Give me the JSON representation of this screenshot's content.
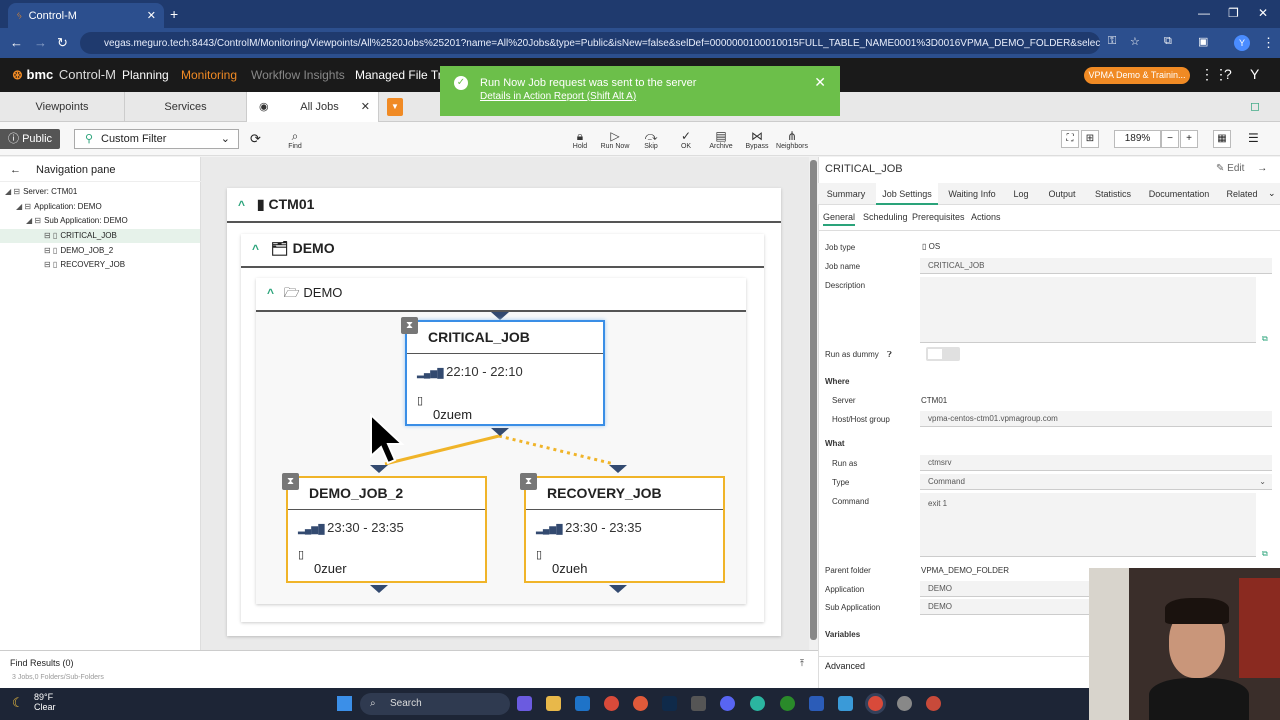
{
  "browser": {
    "tab_title": "Control-M",
    "url": "vegas.meguro.tech:8443/ControlM/Monitoring/Viewpoints/All%2520Jobs%25201?name=All%20Jobs&type=Public&isNew=false&selDef=0000000100010015FULL_TABLE_NAME0001%3D0016VPMA_DEMO_FOLDER&selectedEntity=ControlM...",
    "profile_initial": "Y"
  },
  "app": {
    "brand": "bmc",
    "product": "Control-M",
    "nav": [
      "Planning",
      "Monitoring",
      "Workflow Insights",
      "Managed File Tra"
    ],
    "env_badge": "VPMA Demo & Trainin...",
    "user_initial": "Y"
  },
  "toast": {
    "message": "Run Now Job request was sent to the server",
    "link": "Details in Action Report (Shift Alt A)"
  },
  "view_tabs": [
    "Viewpoints",
    "Services",
    "All Jobs"
  ],
  "toolbar": {
    "scope": "Public",
    "filter": "Custom Filter",
    "find": "Find",
    "actions": [
      "Hold",
      "Run Now",
      "Skip",
      "OK",
      "Archive",
      "Bypass",
      "Neighbors"
    ],
    "zoom": "189%"
  },
  "nav_pane": {
    "title": "Navigation pane",
    "tree": [
      {
        "label": "Server: CTM01"
      },
      {
        "label": "Application: DEMO"
      },
      {
        "label": "Sub Application: DEMO"
      },
      {
        "label": "CRITICAL_JOB"
      },
      {
        "label": "DEMO_JOB_2"
      },
      {
        "label": "RECOVERY_JOB"
      }
    ]
  },
  "canvas": {
    "server": "CTM01",
    "app_folder": "DEMO",
    "sub_folder": "DEMO",
    "jobs": [
      {
        "name": "CRITICAL_JOB",
        "time": "22:10 - 22:10",
        "host": "0zuem"
      },
      {
        "name": "DEMO_JOB_2",
        "time": "23:30 - 23:35",
        "host": "0zuer"
      },
      {
        "name": "RECOVERY_JOB",
        "time": "23:30 - 23:35",
        "host": "0zueh"
      }
    ]
  },
  "find_results": "Find Results (0)",
  "status_line": "3 Jobs,0 Folders/Sub-Folders",
  "details": {
    "title": "CRITICAL_JOB",
    "edit": "Edit",
    "tabs": [
      "Summary",
      "Job Settings",
      "Waiting Info",
      "Log",
      "Output",
      "Statistics",
      "Documentation",
      "Related"
    ],
    "subtabs": [
      "General",
      "Scheduling",
      "Prerequisites",
      "Actions"
    ],
    "job_type_label": "Job type",
    "job_type": "OS",
    "job_name_label": "Job name",
    "job_name": "CRITICAL_JOB",
    "description_label": "Description",
    "dummy_label": "Run as dummy",
    "where_label": "Where",
    "server_label": "Server",
    "server": "CTM01",
    "host_label": "Host/Host group",
    "host": "vpma-centos-ctm01.vpmagroup.com",
    "what_label": "What",
    "runas_label": "Run as",
    "runas": "ctmsrv",
    "type_label": "Type",
    "type": "Command",
    "command_label": "Command",
    "command": "exit 1",
    "parent_label": "Parent folder",
    "parent": "VPMA_DEMO_FOLDER",
    "application_label": "Application",
    "application": "DEMO",
    "subapp_label": "Sub Application",
    "subapp": "DEMO",
    "variables_label": "Variables",
    "advanced_label": "Advanced"
  },
  "taskbar": {
    "temp": "89°F",
    "condition": "Clear",
    "search": "Search"
  },
  "colors": {
    "accent_orange": "#f08a24",
    "toast_green": "#6cbf4a",
    "job_blue": "#3a8ee6",
    "job_yellow": "#f0b429"
  }
}
